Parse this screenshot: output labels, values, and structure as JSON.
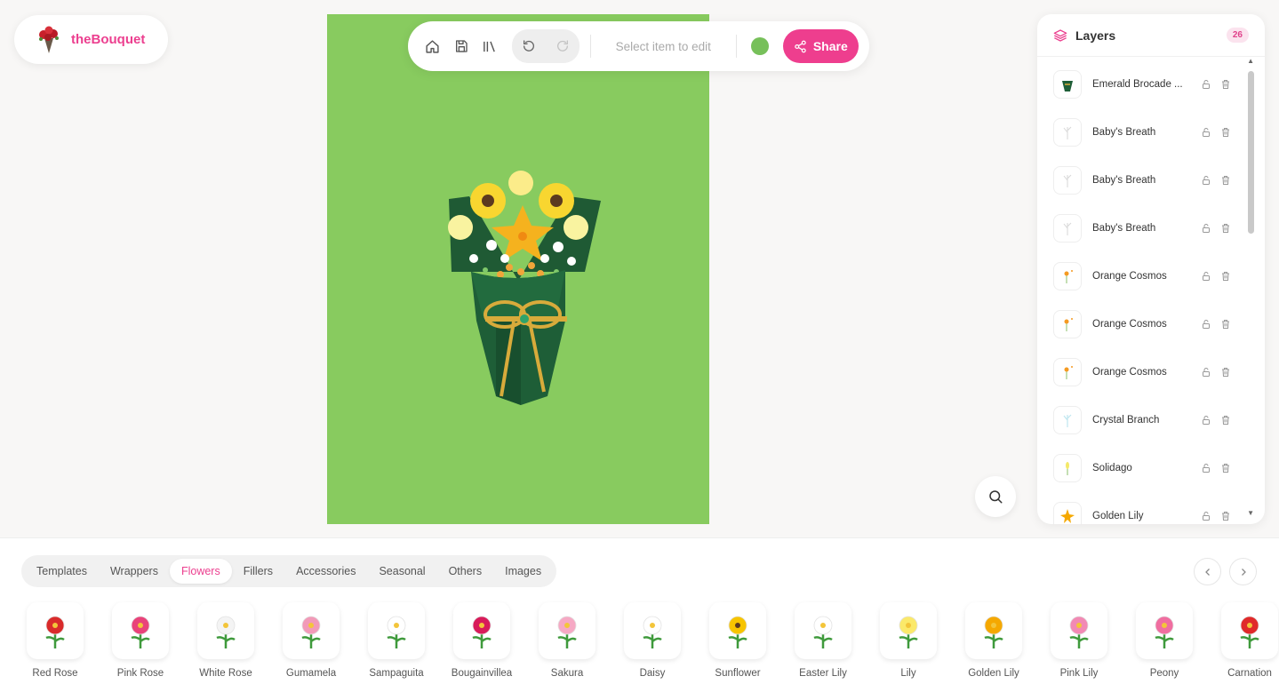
{
  "app": {
    "name": "theBouquet"
  },
  "toolbar": {
    "home_icon": "home-icon",
    "save_icon": "save-icon",
    "library_icon": "library-icon",
    "undo_icon": "undo-icon",
    "redo_icon": "redo-icon",
    "hint": "Select item to edit",
    "color": "#77c05a",
    "share_label": "Share"
  },
  "canvas": {
    "background": "#88cb5f"
  },
  "layers": {
    "title": "Layers",
    "count": "26",
    "items": [
      {
        "name": "Emerald Brocade ...",
        "icon": "wrapper"
      },
      {
        "name": "Baby's Breath",
        "icon": "stem"
      },
      {
        "name": "Baby's Breath",
        "icon": "stem"
      },
      {
        "name": "Baby's Breath",
        "icon": "stem"
      },
      {
        "name": "Orange Cosmos",
        "icon": "cosmos"
      },
      {
        "name": "Orange Cosmos",
        "icon": "cosmos"
      },
      {
        "name": "Orange Cosmos",
        "icon": "cosmos"
      },
      {
        "name": "Crystal Branch",
        "icon": "crystal"
      },
      {
        "name": "Solidago",
        "icon": "solidago"
      },
      {
        "name": "Golden Lily",
        "icon": "goldenlily"
      }
    ]
  },
  "tabs": [
    {
      "label": "Templates",
      "active": false
    },
    {
      "label": "Wrappers",
      "active": false
    },
    {
      "label": "Flowers",
      "active": true
    },
    {
      "label": "Fillers",
      "active": false
    },
    {
      "label": "Accessories",
      "active": false
    },
    {
      "label": "Seasonal",
      "active": false
    },
    {
      "label": "Others",
      "active": false
    },
    {
      "label": "Images",
      "active": false
    }
  ],
  "flowers": [
    {
      "label": "Red Rose",
      "color": "#d92b2b"
    },
    {
      "label": "Pink Rose",
      "color": "#e9437a"
    },
    {
      "label": "White Rose",
      "color": "#f4f4f4"
    },
    {
      "label": "Gumamela",
      "color": "#f29ab8"
    },
    {
      "label": "Sampaguita",
      "color": "#ffffff"
    },
    {
      "label": "Bougainvillea",
      "color": "#d81b5a"
    },
    {
      "label": "Sakura",
      "color": "#f6a9c4"
    },
    {
      "label": "Daisy",
      "color": "#ffffff"
    },
    {
      "label": "Sunflower",
      "color": "#f7c400"
    },
    {
      "label": "Easter Lily",
      "color": "#ffffff"
    },
    {
      "label": "Lily",
      "color": "#fbe96a"
    },
    {
      "label": "Golden Lily",
      "color": "#f5a800"
    },
    {
      "label": "Pink Lily",
      "color": "#f28ab4"
    },
    {
      "label": "Peony",
      "color": "#f06ea0"
    },
    {
      "label": "Carnation",
      "color": "#e02a2a"
    }
  ]
}
